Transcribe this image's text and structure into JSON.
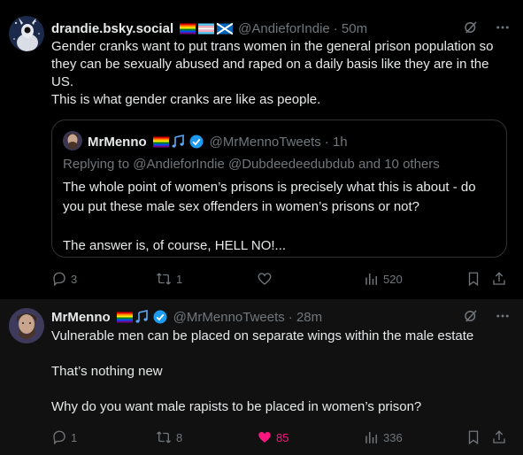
{
  "tweets": [
    {
      "author": {
        "name": "drandie.bsky.social",
        "handle": "@AndieforIndie",
        "time": "· 50m"
      },
      "text": "Gender cranks want to put trans women in the general prison population so they can be sexually abused and raped on a daily basis like they are in the US.\nThis is what gender cranks are like as people.",
      "quote": {
        "author": {
          "name": "MrMenno",
          "handle": "@MrMennoTweets",
          "time": "· 1h"
        },
        "replying_to": "Replying to @AndieforIndie @Dubdeedeedubdub and 10 others",
        "text": "The whole point of women’s prisons is precisely what this is about - do you put these male sex offenders in women’s prisons or not?\n\nThe answer is, of course, HELL NO!..."
      },
      "stats": {
        "replies": "3",
        "reposts": "1",
        "likes": "",
        "views": "520"
      }
    },
    {
      "author": {
        "name": "MrMenno",
        "handle": "@MrMennoTweets",
        "time": "· 28m"
      },
      "text": "Vulnerable men can be placed on separate wings within the male estate\n\nThat’s nothing new\n\nWhy do you want male rapists to be placed in women’s prison?",
      "stats": {
        "replies": "1",
        "reposts": "8",
        "likes": "85",
        "views": "336"
      }
    }
  ],
  "colors": {
    "background": "#000000",
    "text": "#e7e9ea",
    "secondary": "#71767b",
    "border": "#2f3336",
    "liked": "#f91880",
    "verified": "#1d9bf0"
  },
  "icons": [
    "grok-icon",
    "more-icon",
    "reply-icon",
    "repost-icon",
    "like-icon",
    "views-icon",
    "bookmark-icon",
    "share-icon",
    "verified-badge-icon"
  ]
}
